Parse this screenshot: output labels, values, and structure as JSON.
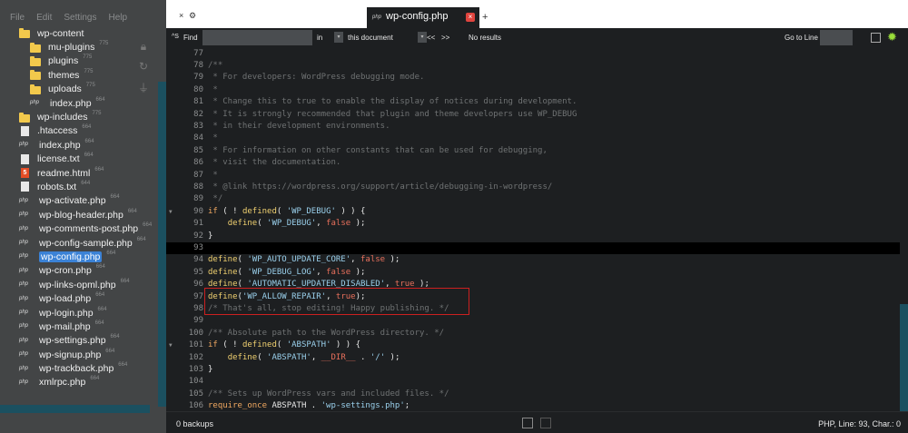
{
  "menu": [
    "File",
    "Edit",
    "Settings",
    "Help"
  ],
  "tree": [
    {
      "name": "wp-content",
      "icon": "folder-icon",
      "indent": 1,
      "count": "",
      "cut": true
    },
    {
      "name": "mu-plugins",
      "icon": "folder-icon",
      "indent": 2,
      "count": "775"
    },
    {
      "name": "plugins",
      "icon": "folder-icon",
      "indent": 2,
      "count": "775"
    },
    {
      "name": "themes",
      "icon": "folder-icon",
      "indent": 2,
      "count": "775"
    },
    {
      "name": "uploads",
      "icon": "folder-icon",
      "indent": 2,
      "count": "775"
    },
    {
      "name": "index.php",
      "icon": "php-file-icon",
      "indent": 2,
      "count": "664"
    },
    {
      "name": "wp-includes",
      "icon": "folder-icon",
      "indent": 1,
      "count": "775"
    },
    {
      "name": ".htaccess",
      "icon": "text-file-icon",
      "indent": 1,
      "count": "664"
    },
    {
      "name": "index.php",
      "icon": "php-file-icon",
      "indent": 1,
      "count": "664"
    },
    {
      "name": "license.txt",
      "icon": "text-file-icon",
      "indent": 1,
      "count": "664"
    },
    {
      "name": "readme.html",
      "icon": "html-file-icon",
      "indent": 1,
      "count": "664"
    },
    {
      "name": "robots.txt",
      "icon": "text-file-icon",
      "indent": 1,
      "count": "644"
    },
    {
      "name": "wp-activate.php",
      "icon": "php-file-icon",
      "indent": 1,
      "count": "664"
    },
    {
      "name": "wp-blog-header.php",
      "icon": "php-file-icon",
      "indent": 1,
      "count": "664"
    },
    {
      "name": "wp-comments-post.php",
      "icon": "php-file-icon",
      "indent": 1,
      "count": "664"
    },
    {
      "name": "wp-config-sample.php",
      "icon": "php-file-icon",
      "indent": 1,
      "count": "664"
    },
    {
      "name": "wp-config.php",
      "icon": "php-file-icon",
      "indent": 1,
      "count": "664",
      "selected": true
    },
    {
      "name": "wp-cron.php",
      "icon": "php-file-icon",
      "indent": 1,
      "count": "664"
    },
    {
      "name": "wp-links-opml.php",
      "icon": "php-file-icon",
      "indent": 1,
      "count": "664"
    },
    {
      "name": "wp-load.php",
      "icon": "php-file-icon",
      "indent": 1,
      "count": "664"
    },
    {
      "name": "wp-login.php",
      "icon": "php-file-icon",
      "indent": 1,
      "count": "664"
    },
    {
      "name": "wp-mail.php",
      "icon": "php-file-icon",
      "indent": 1,
      "count": "664"
    },
    {
      "name": "wp-settings.php",
      "icon": "php-file-icon",
      "indent": 1,
      "count": "664"
    },
    {
      "name": "wp-signup.php",
      "icon": "php-file-icon",
      "indent": 1,
      "count": "664"
    },
    {
      "name": "wp-trackback.php",
      "icon": "php-file-icon",
      "indent": 1,
      "count": "664"
    },
    {
      "name": "xmlrpc.php",
      "icon": "php-file-icon",
      "indent": 1,
      "count": "664"
    }
  ],
  "side_icons": [
    "lock-icon",
    "refresh-icon",
    "plug-icon"
  ],
  "tabs": {
    "controls": [
      "×",
      "⚙"
    ],
    "active": {
      "label": "wp-config.php",
      "file_type": "php",
      "close": "×"
    },
    "add_label": "+"
  },
  "findbar": {
    "shortcut_label": "^S",
    "find_label": "Find",
    "find_value": "",
    "in_label": "in",
    "scope": "this document",
    "prev_label": "<<",
    "next_label": ">>",
    "results": "No results",
    "goto_label": "Go to Line",
    "goto_value": ""
  },
  "editor": {
    "current_line": 93,
    "lines": [
      {
        "n": 77,
        "t": [
          [
            "",
            "p"
          ]
        ]
      },
      {
        "n": 78,
        "t": [
          [
            "/**",
            "c"
          ]
        ]
      },
      {
        "n": 79,
        "t": [
          [
            " * For developers: WordPress debugging mode.",
            "c"
          ]
        ]
      },
      {
        "n": 80,
        "t": [
          [
            " *",
            "c"
          ]
        ]
      },
      {
        "n": 81,
        "t": [
          [
            " * Change this to true to enable the display of notices during development.",
            "c"
          ]
        ]
      },
      {
        "n": 82,
        "t": [
          [
            " * It is strongly recommended that plugin and theme developers use WP_DEBUG",
            "c"
          ]
        ]
      },
      {
        "n": 83,
        "t": [
          [
            " * in their development environments.",
            "c"
          ]
        ]
      },
      {
        "n": 84,
        "t": [
          [
            " *",
            "c"
          ]
        ]
      },
      {
        "n": 85,
        "t": [
          [
            " * For information on other constants that can be used for debugging,",
            "c"
          ]
        ]
      },
      {
        "n": 86,
        "t": [
          [
            " * visit the documentation.",
            "c"
          ]
        ]
      },
      {
        "n": 87,
        "t": [
          [
            " *",
            "c"
          ]
        ]
      },
      {
        "n": 88,
        "t": [
          [
            " * @link https://wordpress.org/support/article/debugging-in-wordpress/",
            "c"
          ]
        ]
      },
      {
        "n": 89,
        "t": [
          [
            " */",
            "c"
          ]
        ]
      },
      {
        "n": 90,
        "fold": true,
        "t": [
          [
            "if",
            "k"
          ],
          [
            " ( ! ",
            "p"
          ],
          [
            "defined",
            "f"
          ],
          [
            "( ",
            "p"
          ],
          [
            "'WP_DEBUG'",
            "s"
          ],
          [
            " ) ) {",
            "p"
          ]
        ]
      },
      {
        "n": 91,
        "t": [
          [
            "    ",
            "p"
          ],
          [
            "define",
            "f"
          ],
          [
            "( ",
            "p"
          ],
          [
            "'WP_DEBUG'",
            "s"
          ],
          [
            ", ",
            "p"
          ],
          [
            "false",
            "v"
          ],
          [
            " );",
            "p"
          ]
        ]
      },
      {
        "n": 92,
        "t": [
          [
            "}",
            "p"
          ]
        ]
      },
      {
        "n": 93,
        "t": [
          [
            "",
            "p"
          ]
        ]
      },
      {
        "n": 94,
        "t": [
          [
            "define",
            "f"
          ],
          [
            "( ",
            "p"
          ],
          [
            "'WP_AUTO_UPDATE_CORE'",
            "s"
          ],
          [
            ", ",
            "p"
          ],
          [
            "false",
            "v"
          ],
          [
            " );",
            "p"
          ]
        ]
      },
      {
        "n": 95,
        "t": [
          [
            "define",
            "f"
          ],
          [
            "( ",
            "p"
          ],
          [
            "'WP_DEBUG_LOG'",
            "s"
          ],
          [
            ", ",
            "p"
          ],
          [
            "false",
            "v"
          ],
          [
            " );",
            "p"
          ]
        ]
      },
      {
        "n": 96,
        "t": [
          [
            "define",
            "f"
          ],
          [
            "( ",
            "p"
          ],
          [
            "'AUTOMATIC_UPDATER_DISABLED'",
            "s"
          ],
          [
            ", ",
            "p"
          ],
          [
            "true",
            "v"
          ],
          [
            " );",
            "p"
          ]
        ]
      },
      {
        "n": 97,
        "t": [
          [
            "define",
            "f"
          ],
          [
            "(",
            "p"
          ],
          [
            "'WP_ALLOW_REPAIR'",
            "s"
          ],
          [
            ", ",
            "p"
          ],
          [
            "true",
            "v"
          ],
          [
            ");",
            "p"
          ]
        ]
      },
      {
        "n": 98,
        "t": [
          [
            "/* That's all, stop editing! Happy publishing. */",
            "c"
          ]
        ]
      },
      {
        "n": 99,
        "t": [
          [
            "",
            "p"
          ]
        ]
      },
      {
        "n": 100,
        "t": [
          [
            "/** Absolute path to the WordPress directory. */",
            "c"
          ]
        ]
      },
      {
        "n": 101,
        "fold": true,
        "t": [
          [
            "if",
            "k"
          ],
          [
            " ( ! ",
            "p"
          ],
          [
            "defined",
            "f"
          ],
          [
            "( ",
            "p"
          ],
          [
            "'ABSPATH'",
            "s"
          ],
          [
            " ) ) {",
            "p"
          ]
        ]
      },
      {
        "n": 102,
        "t": [
          [
            "    ",
            "p"
          ],
          [
            "define",
            "f"
          ],
          [
            "( ",
            "p"
          ],
          [
            "'ABSPATH'",
            "s"
          ],
          [
            ", ",
            "p"
          ],
          [
            "__DIR__",
            "v"
          ],
          [
            " . ",
            "p"
          ],
          [
            "'/'",
            "s"
          ],
          [
            " );",
            "p"
          ]
        ]
      },
      {
        "n": 103,
        "t": [
          [
            "}",
            "p"
          ]
        ]
      },
      {
        "n": 104,
        "t": [
          [
            "",
            "p"
          ]
        ]
      },
      {
        "n": 105,
        "t": [
          [
            "/** Sets up WordPress vars and included files. */",
            "c"
          ]
        ]
      },
      {
        "n": 106,
        "t": [
          [
            "require_once",
            "k"
          ],
          [
            " ABSPATH . ",
            "p"
          ],
          [
            "'wp-settings.php'",
            "s"
          ],
          [
            ";",
            "p"
          ]
        ]
      }
    ]
  },
  "status": {
    "backups": "0 backups",
    "position": "PHP, Line: 93, Char.: 0"
  },
  "colors": {
    "sidebar": "#434546",
    "editor_bg": "#1d1f21",
    "selection": "#3b82d6",
    "highlight_box": "#cc2020",
    "scrollbar": "#1b5060"
  }
}
